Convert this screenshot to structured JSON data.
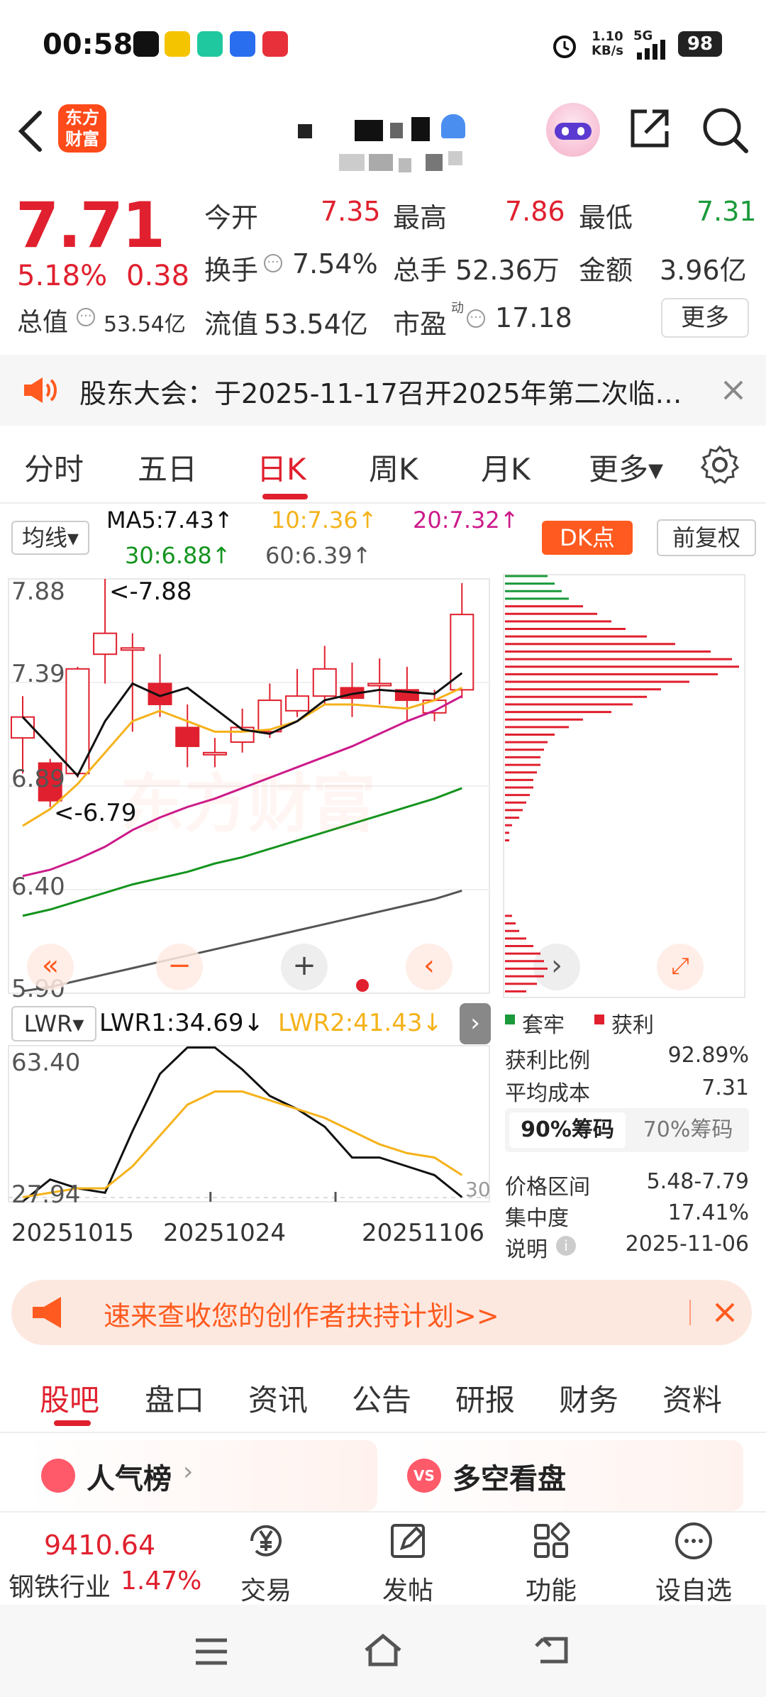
{
  "status_bar": {
    "time": "00:58",
    "net_speed": "1.10",
    "net_unit": "KB/s",
    "network": "5G",
    "battery": "98"
  },
  "header": {
    "logo_line1": "东方",
    "logo_line2": "财富"
  },
  "quote": {
    "price": "7.71",
    "change_pct": "5.18%",
    "change_abs": "0.38",
    "open_label": "今开",
    "open_value": "7.35",
    "high_label": "最高",
    "high_value": "7.86",
    "low_label": "最低",
    "low_value": "7.31",
    "turnover_label": "换手",
    "turnover_value": "7.54%",
    "volume_label": "总手",
    "volume_value": "52.36万",
    "amount_label": "金额",
    "amount_value": "3.96亿",
    "market_cap_label": "总值",
    "market_cap_value": "53.54亿",
    "float_cap_label": "流值",
    "float_cap_value": "53.54亿",
    "pe_label": "市盈",
    "pe_sup": "动",
    "pe_value": "17.18",
    "more_button": "更多"
  },
  "notice": {
    "text": "股东大会：于2025-11-17召开2025年第二次临…"
  },
  "chart_tabs": {
    "items": [
      "分时",
      "五日",
      "日K",
      "周K",
      "月K"
    ],
    "active": "日K",
    "more": "更多▾"
  },
  "ma_bar": {
    "selector": "均线▾",
    "ma5": "MA5:7.43↑",
    "ma10": "10:7.36↑",
    "ma20": "20:7.32↑",
    "ma30": "30:6.88↑",
    "ma60": "60:6.39↑",
    "dk_button": "DK点",
    "adjust_button": "前复权"
  },
  "kline": {
    "y_labels": [
      "7.88",
      "7.39",
      "6.89",
      "6.40",
      "5.90"
    ],
    "max_marker": "<-7.88",
    "min_marker": "<-6.79",
    "watermark": "东方财富"
  },
  "lwr": {
    "selector": "LWR▾",
    "lwr1": "LWR1:34.69↓",
    "lwr2": "LWR2:41.43↓",
    "top_label": "63.40",
    "bottom_label": "27.94",
    "right_label": "30",
    "dates": [
      "20251015",
      "20251024",
      "20251106"
    ]
  },
  "chips": {
    "legend_trapped": "套牢",
    "legend_profit": "获利",
    "profit_ratio_label": "获利比例",
    "profit_ratio_value": "92.89%",
    "avg_cost_label": "平均成本",
    "avg_cost_value": "7.31",
    "tab_90": "90%筹码",
    "tab_70": "70%筹码",
    "range_label": "价格区间",
    "range_value": "5.48-7.79",
    "concentration_label": "集中度",
    "concentration_value": "17.41%",
    "note_label": "说明",
    "note_value": "2025-11-06"
  },
  "promo": {
    "text": "速来查收您的创作者扶持计划>>"
  },
  "bottom_tabs": {
    "items": [
      "股吧",
      "盘口",
      "资讯",
      "公告",
      "研报",
      "财务",
      "资料"
    ],
    "active": "股吧"
  },
  "cards": {
    "popularity": "人气榜",
    "long_short": "多空看盘"
  },
  "footer": {
    "index_value": "9410.64",
    "industry_name": "钢铁行业",
    "industry_change": "1.47%",
    "trade": "交易",
    "post": "发帖",
    "functions": "功能",
    "add_watch": "设自选"
  },
  "colors": {
    "up_red": "#e0202e",
    "down_green": "#1a9a3a",
    "ma5_black": "#111111",
    "ma10_orange": "#f5b21a",
    "ma20_magenta": "#cc1a8a",
    "ma30_green": "#14941e",
    "ma60_gray": "#555555",
    "brand_orange": "#ff5a1f"
  },
  "chart_data": {
    "type": "candlestick",
    "y_range": [
      5.9,
      7.88
    ],
    "candles": [
      {
        "o": 7.12,
        "c": 7.22,
        "h": 7.32,
        "l": 6.95
      },
      {
        "o": 7.0,
        "c": 6.82,
        "h": 7.02,
        "l": 6.79
      },
      {
        "o": 6.95,
        "c": 7.45,
        "h": 7.46,
        "l": 6.93
      },
      {
        "o": 7.52,
        "c": 7.62,
        "h": 7.88,
        "l": 7.38
      },
      {
        "o": 7.55,
        "c": 7.55,
        "h": 7.62,
        "l": 7.15
      },
      {
        "o": 7.38,
        "c": 7.28,
        "h": 7.52,
        "l": 7.22
      },
      {
        "o": 7.17,
        "c": 7.08,
        "h": 7.28,
        "l": 6.98
      },
      {
        "o": 7.05,
        "c": 7.05,
        "h": 7.12,
        "l": 6.98
      },
      {
        "o": 7.1,
        "c": 7.17,
        "h": 7.26,
        "l": 7.05
      },
      {
        "o": 7.15,
        "c": 7.3,
        "h": 7.38,
        "l": 7.12
      },
      {
        "o": 7.25,
        "c": 7.32,
        "h": 7.45,
        "l": 7.22
      },
      {
        "o": 7.32,
        "c": 7.45,
        "h": 7.56,
        "l": 7.28
      },
      {
        "o": 7.36,
        "c": 7.31,
        "h": 7.48,
        "l": 7.22
      },
      {
        "o": 7.38,
        "c": 7.38,
        "h": 7.5,
        "l": 7.28
      },
      {
        "o": 7.35,
        "c": 7.3,
        "h": 7.46,
        "l": 7.2
      },
      {
        "o": 7.24,
        "c": 7.3,
        "h": 7.35,
        "l": 7.2
      },
      {
        "o": 7.35,
        "c": 7.71,
        "h": 7.86,
        "l": 7.31
      }
    ],
    "ma5": [
      7.22,
      7.08,
      6.94,
      7.2,
      7.38,
      7.32,
      7.36,
      7.26,
      7.16,
      7.14,
      7.2,
      7.3,
      7.33,
      7.35,
      7.34,
      7.33,
      7.43
    ],
    "ma10": [
      6.7,
      6.78,
      6.9,
      7.05,
      7.2,
      7.25,
      7.2,
      7.15,
      7.15,
      7.16,
      7.2,
      7.28,
      7.28,
      7.27,
      7.26,
      7.3,
      7.36
    ],
    "ma20": [
      6.46,
      6.49,
      6.54,
      6.6,
      6.68,
      6.74,
      6.79,
      6.83,
      6.88,
      6.93,
      6.98,
      7.03,
      7.08,
      7.14,
      7.2,
      7.25,
      7.32
    ],
    "ma30": [
      6.27,
      6.3,
      6.34,
      6.38,
      6.42,
      6.45,
      6.48,
      6.52,
      6.55,
      6.59,
      6.63,
      6.67,
      6.71,
      6.75,
      6.79,
      6.83,
      6.88
    ],
    "ma60": [
      5.91,
      5.93,
      5.96,
      5.99,
      6.02,
      6.05,
      6.08,
      6.11,
      6.14,
      6.17,
      6.2,
      6.23,
      6.26,
      6.29,
      6.32,
      6.35,
      6.39
    ],
    "lwr1": [
      28,
      33,
      31,
      30,
      44,
      57,
      63,
      63,
      58,
      52,
      49,
      45,
      38,
      38,
      36,
      34,
      29
    ],
    "lwr2": [
      29,
      30,
      31,
      31,
      36,
      43,
      50,
      53,
      53,
      51,
      49,
      47,
      44,
      41,
      39,
      38,
      34
    ],
    "lwr_range": [
      27.94,
      63.4
    ]
  }
}
